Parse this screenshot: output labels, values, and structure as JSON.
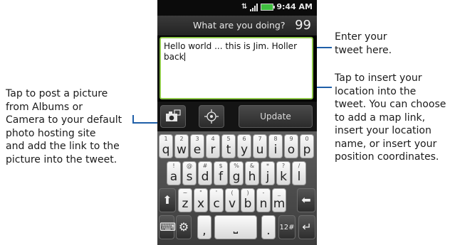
{
  "annotations": {
    "enter_tweet": "Enter your\ntweet here.",
    "insert_location": "Tap to insert your\nlocation into the\ntweet. You can choose\nto add a map link,\ninsert your location\nname, or insert your\nposition coordinates.",
    "post_picture": "Tap to post a picture\nfrom Albums or\nCamera to your default\nphoto hosting site\nand add the link to the\npicture into the tweet."
  },
  "status_bar": {
    "time": "9:44 AM",
    "icons": [
      "data-icon",
      "signal-icon",
      "battery-icon"
    ]
  },
  "compose": {
    "prompt": "What are you doing?",
    "char_count": "99",
    "tweet_text": "Hello world ... this is Jim. Holler back"
  },
  "toolbar": {
    "camera_icon": "camera-icon",
    "location_icon": "location-crosshair-icon",
    "update_label": "Update"
  },
  "keyboard": {
    "row1": [
      {
        "p": "q",
        "s": "1"
      },
      {
        "p": "w",
        "s": "2"
      },
      {
        "p": "e",
        "s": "3"
      },
      {
        "p": "r",
        "s": "4"
      },
      {
        "p": "t",
        "s": "5"
      },
      {
        "p": "y",
        "s": "6"
      },
      {
        "p": "u",
        "s": "7"
      },
      {
        "p": "i",
        "s": "8"
      },
      {
        "p": "o",
        "s": "9"
      },
      {
        "p": "p",
        "s": "0"
      }
    ],
    "row2": [
      {
        "p": "a",
        "s": "!"
      },
      {
        "p": "s",
        "s": "@"
      },
      {
        "p": "d",
        "s": "#"
      },
      {
        "p": "f",
        "s": "$"
      },
      {
        "p": "g",
        "s": "%"
      },
      {
        "p": "h",
        "s": "&"
      },
      {
        "p": "j",
        "s": "*"
      },
      {
        "p": "k",
        "s": "?"
      },
      {
        "p": "l",
        "s": "/"
      }
    ],
    "row3": [
      {
        "p": "z",
        "s": "~"
      },
      {
        "p": "x",
        "s": "\""
      },
      {
        "p": "c",
        "s": "'"
      },
      {
        "p": "v",
        "s": "("
      },
      {
        "p": "b",
        "s": ")"
      },
      {
        "p": "n",
        "s": "-"
      },
      {
        "p": "m",
        "s": "_"
      }
    ],
    "shift_glyph": "⬆",
    "backspace_glyph": "⬅",
    "comma": ",",
    "space_glyph": "⎵",
    "period": ".",
    "numbers_label": "12#",
    "enter_glyph": "↵",
    "settings_glyph": "⚙",
    "keyboard_switch_glyph": "⌨"
  }
}
